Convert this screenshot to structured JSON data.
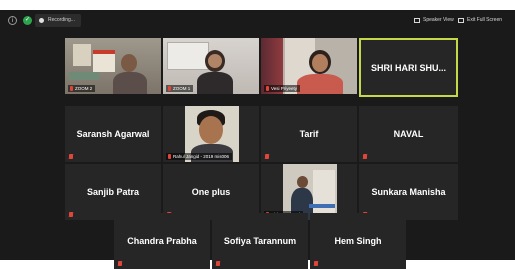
{
  "toolbar": {
    "recording_label": "Recording...",
    "speaker_view_label": "Speaker View",
    "fullscreen_label": "Exit Full Screen"
  },
  "participants": {
    "p1": {
      "name": "ZOOM 2",
      "video": true
    },
    "p2": {
      "name": "ZOOM 1",
      "video": true
    },
    "p3": {
      "name": "Vesi Priyeety",
      "video": true
    },
    "p4": {
      "name": "SHRI HARI SHU...",
      "video": false,
      "active_speaker": true
    },
    "p5": {
      "name": "Saransh Agarwal",
      "video": false
    },
    "p6": {
      "name": "Rahul Jangid - 2019 mis006",
      "video": true
    },
    "p7": {
      "name": "Tarif",
      "video": false
    },
    "p8": {
      "name": "NAVAL",
      "video": false
    },
    "p9": {
      "name": "Sanjib Patra",
      "video": false
    },
    "p10": {
      "name": "One plus",
      "video": false
    },
    "p11": {
      "name": "Kishore Jha Hl",
      "video": true
    },
    "p12": {
      "name": "Sunkara Manisha",
      "video": false
    },
    "p13": {
      "name": "Chandra Prabha",
      "video": false
    },
    "p14": {
      "name": "Sofiya Tarannum",
      "video": false
    },
    "p15": {
      "name": "Hem Singh",
      "video": false
    }
  },
  "colors": {
    "background": "#1a1a1a",
    "tile": "#262626",
    "active_speaker_border": "#c6d84a",
    "muted_mic": "#e0453a"
  }
}
